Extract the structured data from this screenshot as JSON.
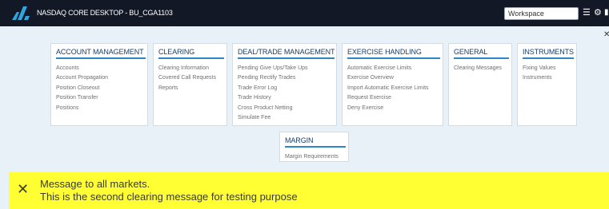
{
  "app": {
    "title": "NASDAQ CORE DESKTOP - BU_CGA1103"
  },
  "toolbar": {
    "workspace_value": "Workspace",
    "menu_icon": "hamburger-icon",
    "settings_icon": "gear-icon"
  },
  "close_icon": "close-icon",
  "cards": [
    {
      "title": "ACCOUNT MANAGEMENT",
      "items": [
        "Accounts",
        "Account Propagation",
        "Position Closeout",
        "Position Transfer",
        "Positions"
      ]
    },
    {
      "title": "CLEARING",
      "items": [
        "Clearing Information",
        "Covered Call Requests",
        "Reports"
      ]
    },
    {
      "title": "DEAL/TRADE MANAGEMENT",
      "items": [
        "Pending Give Ups/Take Ups",
        "Pending Rectify Trades",
        "Trade Error Log",
        "Trade History",
        "Cross Product Netting",
        "Simulate Fee"
      ]
    },
    {
      "title": "EXERCISE HANDLING",
      "items": [
        "Automatic Exercise Limits",
        "Exercise Overview",
        "Import Automatic Exercise Limits",
        "Request Exercise",
        "Deny Exercise"
      ]
    },
    {
      "title": "GENERAL",
      "items": [
        "Clearing Messages"
      ]
    },
    {
      "title": "INSTRUMENTS",
      "items": [
        "Fixing Values",
        "Instruments"
      ]
    },
    {
      "title": "MARGIN",
      "items": [
        "Margin Requirements"
      ]
    }
  ],
  "banner": {
    "line1": "Message to all markets.",
    "line2": "This is the second clearing message for testing purpose",
    "background": "#ffff33"
  },
  "colors": {
    "topbar": "#131826",
    "accent": "#2e86c7",
    "page_bg": "#e8f1f8"
  }
}
